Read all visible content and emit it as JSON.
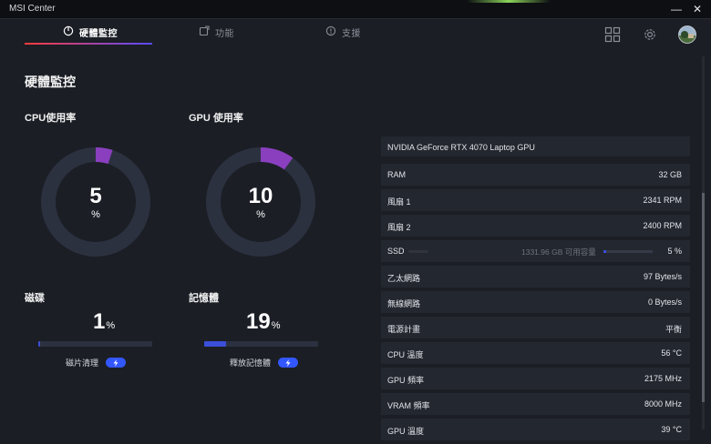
{
  "window": {
    "title": "MSI Center",
    "minimize": "—",
    "close": "✕"
  },
  "tabs": [
    {
      "label": "硬體監控",
      "icon": "gauge-icon",
      "active": true
    },
    {
      "label": "功能",
      "icon": "feature-icon",
      "active": false
    },
    {
      "label": "支援",
      "icon": "support-icon",
      "active": false
    }
  ],
  "toolbar": {
    "icons": [
      "grid-icon",
      "gear-icon",
      "avatar"
    ]
  },
  "section_title": "硬體監控",
  "cpu": {
    "title": "CPU使用率",
    "value": "5",
    "unit": "%",
    "usage_percent": 5
  },
  "gpu": {
    "title": "GPU 使用率",
    "value": "10",
    "unit": "%",
    "usage_percent": 10
  },
  "disk": {
    "title": "磁碟",
    "value": "1",
    "unit": "%",
    "fill_percent": 1,
    "action_label": "磁片清理"
  },
  "memory": {
    "title": "記憶體",
    "value": "19",
    "unit": "%",
    "fill_percent": 19,
    "action_label": "釋放記憶體"
  },
  "stats": {
    "gpu_name": "NVIDIA GeForce RTX 4070 Laptop GPU",
    "rows": [
      {
        "label": "RAM",
        "value": "32 GB"
      },
      {
        "label": "風扇 1",
        "value": "2341 RPM"
      },
      {
        "label": "風扇 2",
        "value": "2400 RPM"
      },
      {
        "label": "SSD",
        "value": "5 %",
        "capacity": "1331.96 GB 可用容量",
        "fill_percent": 5
      },
      {
        "label": "乙太網路",
        "value": "97 Bytes/s"
      },
      {
        "label": "無線網路",
        "value": "0 Bytes/s"
      },
      {
        "label": "電源計畫",
        "value": "平衡"
      },
      {
        "label": "CPU 溫度",
        "value": "56 °C"
      },
      {
        "label": "GPU 頻率",
        "value": "2175 MHz"
      },
      {
        "label": "VRAM 頻率",
        "value": "8000 MHz"
      },
      {
        "label": "GPU 溫度",
        "value": "39 °C"
      }
    ]
  },
  "colors": {
    "accent": "#3b4fd8",
    "ring_fill": "#8a3fbf",
    "ring_track": "#2c3140",
    "tab_underline_start": "#ff3b3b",
    "tab_underline_end": "#5a4bff"
  }
}
